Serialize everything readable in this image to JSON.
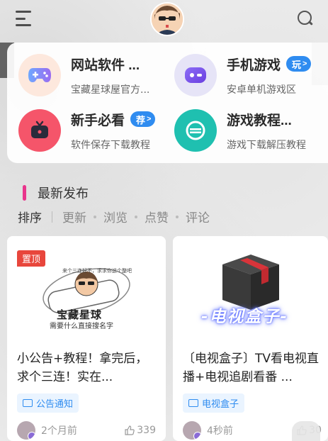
{
  "header": {
    "menu_icon": "menu-icon",
    "search_icon": "search-icon"
  },
  "quick_nav": [
    {
      "title": "网站软件 ...",
      "subtitle": "宝藏星球屋官方...",
      "icon": "gamepad-icon",
      "icon_bg": "#fde8dd",
      "badge": ""
    },
    {
      "title": "手机游戏",
      "subtitle": "安卓单机游戏区",
      "icon": "game-controller-icon",
      "icon_bg": "#e6e4f7",
      "badge": "玩"
    },
    {
      "title": "新手必看",
      "subtitle": "软件保存下载教程",
      "icon": "tv-icon",
      "icon_bg": "#f5556a",
      "badge": "荐"
    },
    {
      "title": "游戏教程...",
      "subtitle": "游戏下载解压教程",
      "icon": "no-entry-icon",
      "icon_bg": "#1fc0b0",
      "badge": ""
    }
  ],
  "section": {
    "title": "最新发布",
    "accent": "#e9358c"
  },
  "sort": {
    "options": [
      "排序",
      "更新",
      "浏览",
      "点赞",
      "评论"
    ]
  },
  "posts": [
    {
      "pinned_label": "置顶",
      "thumb_caption": "宝藏星球",
      "thumb_subcaption": "需要什么直接搜名字",
      "thumb_bubble": "来个三连好不，求求你这个整吧",
      "title": "小公告+教程！拿完后，求个三连！实在...",
      "tag": "公告通知",
      "time": "2个月前",
      "likes": "339"
    },
    {
      "pinned_label": "",
      "thumb_caption": "-电视盒子-",
      "title": "〔电视盒子〕TV看电视直播+电视追剧看番 ...",
      "tag": "电视盒子",
      "time": "4秒前",
      "likes": "30"
    }
  ],
  "colors": {
    "brand_blue": "#2f8cf0",
    "pin_red": "#e8463c"
  }
}
